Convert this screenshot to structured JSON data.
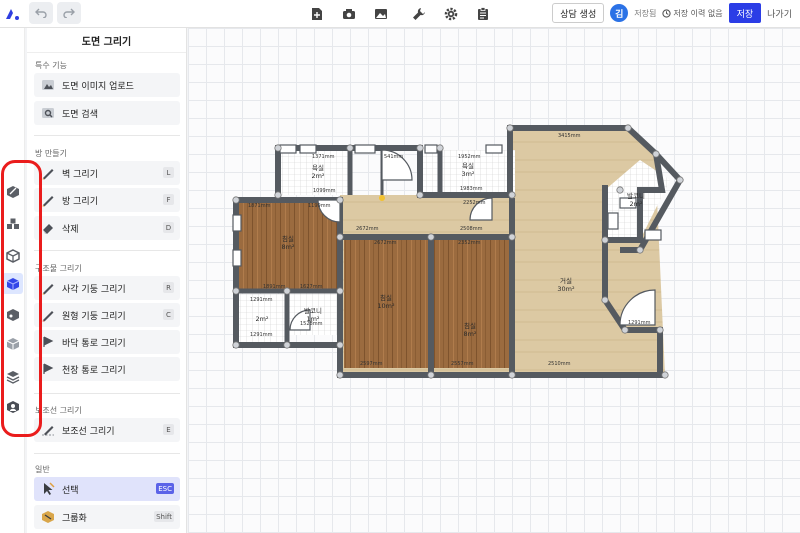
{
  "toolbar": {
    "logo": "app-logo",
    "consult_label": "상담 생성",
    "avatar_initial": "김",
    "saved_status": "저장됨",
    "history_label": "저장 이력 없음",
    "save_label": "저장",
    "exit_label": "나가기"
  },
  "panel": {
    "title": "도면 그리기",
    "sections": {
      "special": "특수 기능",
      "room": "방 만들기",
      "structure": "구조물 그리기",
      "guide": "보조선 그리기",
      "general": "일반"
    },
    "items": {
      "upload": "도면 이미지 업로드",
      "search": "도면 검색",
      "wall": "벽 그리기",
      "room": "방 그리기",
      "delete": "삭제",
      "rect_column": "사각 기둥 그리기",
      "round_column": "원형 기둥 그리기",
      "floor_path": "바닥 통로 그리기",
      "ceiling_path": "천장 통로 그리기",
      "guide_line": "보조선 그리기",
      "select": "선택",
      "group": "그룹화"
    },
    "keys": {
      "wall": "L",
      "room": "F",
      "delete": "D",
      "rect_column": "R",
      "round_column": "C",
      "guide_line": "E",
      "select": "ESC",
      "group": "Shift"
    }
  },
  "floorplan": {
    "rooms": [
      {
        "name": "침실",
        "area": "8m²"
      },
      {
        "name": "욕실",
        "area": "2m²"
      },
      {
        "name": "욕실",
        "area": "3m²"
      },
      {
        "name": "침실",
        "area": "10m²"
      },
      {
        "name": "침실",
        "area": "8m²"
      },
      {
        "name": "거실",
        "area": "30m²"
      },
      {
        "name": "발코니",
        "area": "2m²"
      },
      {
        "name": "",
        "area": "2m²"
      },
      {
        "name": "발코니",
        "area": "1m²"
      }
    ],
    "dimensions": [
      "3415mm",
      "1371mm",
      "541mm",
      "1952mm",
      "1099mm",
      "1983mm",
      "2252mm",
      "1871mm",
      "1199mm",
      "2672mm",
      "2508mm",
      "2672mm",
      "2352mm",
      "1891mm",
      "1627mm",
      "1291mm",
      "1528mm",
      "1291mm",
      "2597mm",
      "2557mm",
      "2510mm",
      "1291mm"
    ],
    "colors": {
      "wall": "#555a60",
      "wood": "#9b6b3f",
      "tile": "#dcc9a3",
      "accent": "#2b3de6"
    }
  }
}
